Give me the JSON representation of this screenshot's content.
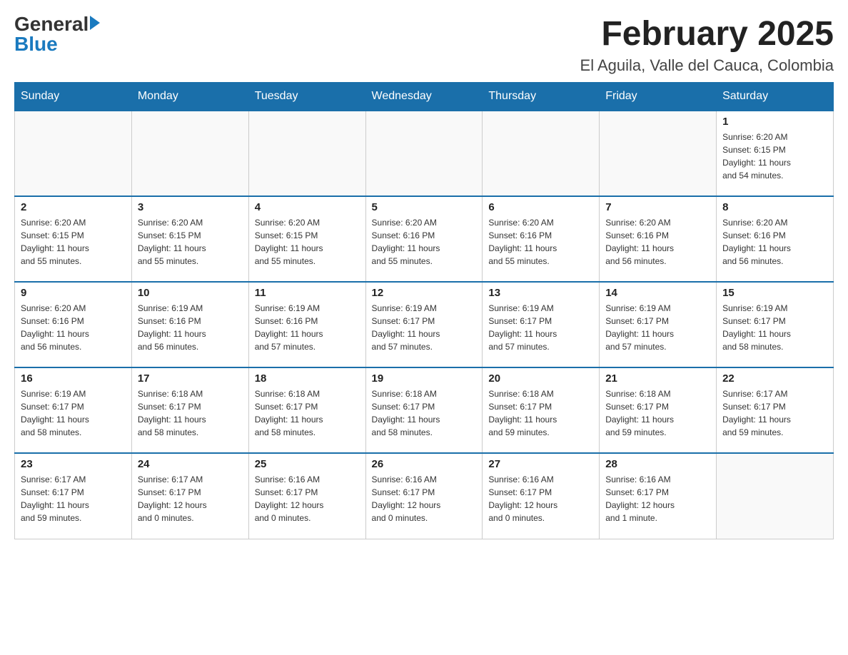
{
  "header": {
    "logo": {
      "general": "General",
      "blue": "Blue",
      "alt": "GeneralBlue logo"
    },
    "title": "February 2025",
    "location": "El Aguila, Valle del Cauca, Colombia"
  },
  "days_of_week": [
    "Sunday",
    "Monday",
    "Tuesday",
    "Wednesday",
    "Thursday",
    "Friday",
    "Saturday"
  ],
  "weeks": [
    {
      "days": [
        {
          "number": "",
          "info": ""
        },
        {
          "number": "",
          "info": ""
        },
        {
          "number": "",
          "info": ""
        },
        {
          "number": "",
          "info": ""
        },
        {
          "number": "",
          "info": ""
        },
        {
          "number": "",
          "info": ""
        },
        {
          "number": "1",
          "info": "Sunrise: 6:20 AM\nSunset: 6:15 PM\nDaylight: 11 hours\nand 54 minutes."
        }
      ]
    },
    {
      "days": [
        {
          "number": "2",
          "info": "Sunrise: 6:20 AM\nSunset: 6:15 PM\nDaylight: 11 hours\nand 55 minutes."
        },
        {
          "number": "3",
          "info": "Sunrise: 6:20 AM\nSunset: 6:15 PM\nDaylight: 11 hours\nand 55 minutes."
        },
        {
          "number": "4",
          "info": "Sunrise: 6:20 AM\nSunset: 6:15 PM\nDaylight: 11 hours\nand 55 minutes."
        },
        {
          "number": "5",
          "info": "Sunrise: 6:20 AM\nSunset: 6:16 PM\nDaylight: 11 hours\nand 55 minutes."
        },
        {
          "number": "6",
          "info": "Sunrise: 6:20 AM\nSunset: 6:16 PM\nDaylight: 11 hours\nand 55 minutes."
        },
        {
          "number": "7",
          "info": "Sunrise: 6:20 AM\nSunset: 6:16 PM\nDaylight: 11 hours\nand 56 minutes."
        },
        {
          "number": "8",
          "info": "Sunrise: 6:20 AM\nSunset: 6:16 PM\nDaylight: 11 hours\nand 56 minutes."
        }
      ]
    },
    {
      "days": [
        {
          "number": "9",
          "info": "Sunrise: 6:20 AM\nSunset: 6:16 PM\nDaylight: 11 hours\nand 56 minutes."
        },
        {
          "number": "10",
          "info": "Sunrise: 6:19 AM\nSunset: 6:16 PM\nDaylight: 11 hours\nand 56 minutes."
        },
        {
          "number": "11",
          "info": "Sunrise: 6:19 AM\nSunset: 6:16 PM\nDaylight: 11 hours\nand 57 minutes."
        },
        {
          "number": "12",
          "info": "Sunrise: 6:19 AM\nSunset: 6:17 PM\nDaylight: 11 hours\nand 57 minutes."
        },
        {
          "number": "13",
          "info": "Sunrise: 6:19 AM\nSunset: 6:17 PM\nDaylight: 11 hours\nand 57 minutes."
        },
        {
          "number": "14",
          "info": "Sunrise: 6:19 AM\nSunset: 6:17 PM\nDaylight: 11 hours\nand 57 minutes."
        },
        {
          "number": "15",
          "info": "Sunrise: 6:19 AM\nSunset: 6:17 PM\nDaylight: 11 hours\nand 58 minutes."
        }
      ]
    },
    {
      "days": [
        {
          "number": "16",
          "info": "Sunrise: 6:19 AM\nSunset: 6:17 PM\nDaylight: 11 hours\nand 58 minutes."
        },
        {
          "number": "17",
          "info": "Sunrise: 6:18 AM\nSunset: 6:17 PM\nDaylight: 11 hours\nand 58 minutes."
        },
        {
          "number": "18",
          "info": "Sunrise: 6:18 AM\nSunset: 6:17 PM\nDaylight: 11 hours\nand 58 minutes."
        },
        {
          "number": "19",
          "info": "Sunrise: 6:18 AM\nSunset: 6:17 PM\nDaylight: 11 hours\nand 58 minutes."
        },
        {
          "number": "20",
          "info": "Sunrise: 6:18 AM\nSunset: 6:17 PM\nDaylight: 11 hours\nand 59 minutes."
        },
        {
          "number": "21",
          "info": "Sunrise: 6:18 AM\nSunset: 6:17 PM\nDaylight: 11 hours\nand 59 minutes."
        },
        {
          "number": "22",
          "info": "Sunrise: 6:17 AM\nSunset: 6:17 PM\nDaylight: 11 hours\nand 59 minutes."
        }
      ]
    },
    {
      "days": [
        {
          "number": "23",
          "info": "Sunrise: 6:17 AM\nSunset: 6:17 PM\nDaylight: 11 hours\nand 59 minutes."
        },
        {
          "number": "24",
          "info": "Sunrise: 6:17 AM\nSunset: 6:17 PM\nDaylight: 12 hours\nand 0 minutes."
        },
        {
          "number": "25",
          "info": "Sunrise: 6:16 AM\nSunset: 6:17 PM\nDaylight: 12 hours\nand 0 minutes."
        },
        {
          "number": "26",
          "info": "Sunrise: 6:16 AM\nSunset: 6:17 PM\nDaylight: 12 hours\nand 0 minutes."
        },
        {
          "number": "27",
          "info": "Sunrise: 6:16 AM\nSunset: 6:17 PM\nDaylight: 12 hours\nand 0 minutes."
        },
        {
          "number": "28",
          "info": "Sunrise: 6:16 AM\nSunset: 6:17 PM\nDaylight: 12 hours\nand 1 minute."
        },
        {
          "number": "",
          "info": ""
        }
      ]
    }
  ]
}
